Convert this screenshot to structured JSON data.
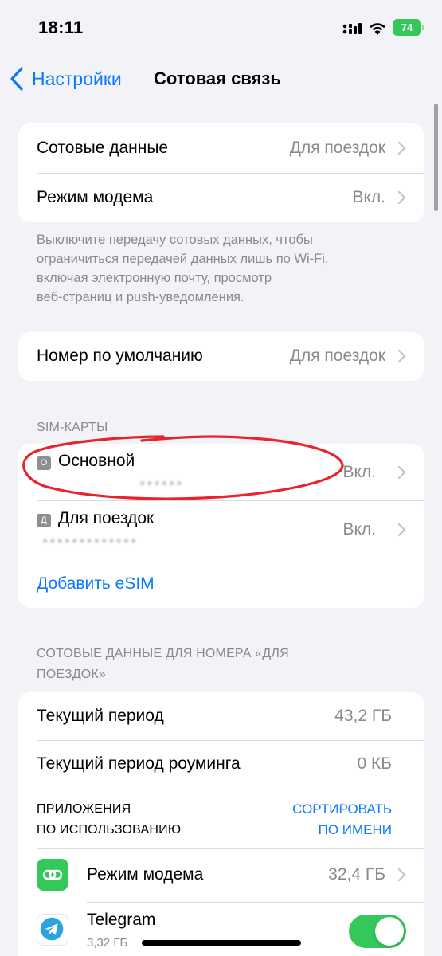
{
  "status_bar": {
    "time": "18:11",
    "battery": "74"
  },
  "nav": {
    "back_label": "Настройки",
    "title": "Сотовая связь"
  },
  "section1": {
    "rows": [
      {
        "label": "Сотовые данные",
        "value": "Для поездок"
      },
      {
        "label": "Режим модема",
        "value": "Вкл."
      }
    ],
    "footer": [
      "Выключите передачу сотовых данных, чтобы",
      "ограничиться передачей данных лишь по Wi‑Fi,",
      "включая электронную почту, просмотр",
      "веб‑страниц и push‑уведомления."
    ]
  },
  "section2": {
    "label": "Номер по умолчанию",
    "value": "Для поездок"
  },
  "sim": {
    "header": "SIM-КАРТЫ",
    "items": [
      {
        "badge": "О",
        "label": "Основной",
        "value": "Вкл."
      },
      {
        "badge": "Д",
        "label": "Для поездок",
        "value": "Вкл."
      }
    ],
    "add_esim": "Добавить eSIM"
  },
  "usage": {
    "header": [
      "СОТОВЫЕ ДАННЫЕ ДЛЯ НОМЕРА «ДЛЯ",
      "ПОЕЗДОК»"
    ],
    "rows": [
      {
        "label": "Текущий период",
        "value": "43,2 ГБ"
      },
      {
        "label": "Текущий период роуминга",
        "value": "0 КБ"
      }
    ],
    "apps_header": [
      "ПРИЛОЖЕНИЯ",
      "ПО ИСПОЛЬЗОВАНИЮ"
    ],
    "sort": [
      "СОРТИРОВАТЬ",
      "ПО ИМЕНИ"
    ],
    "apps": [
      {
        "icon": "hotspot-icon",
        "name": "Режим модема",
        "value": "32,4 ГБ"
      },
      {
        "icon": "telegram-icon",
        "name": "Telegram",
        "sub": "3,32 ГБ",
        "enabled": true
      }
    ]
  },
  "colors": {
    "accent": "#0a7aff",
    "green": "#34c759",
    "annotation": "#e8232a"
  }
}
